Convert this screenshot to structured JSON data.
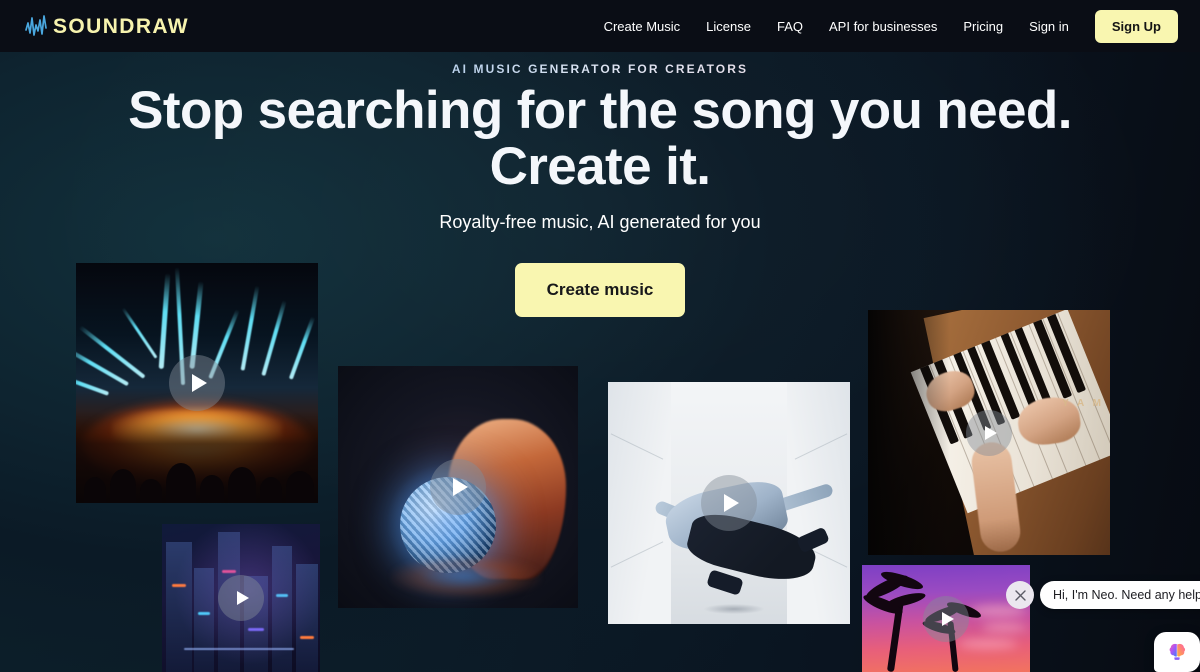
{
  "header": {
    "logo": {
      "mark_icon": "waveform-icon",
      "text": "SOUNDRAW"
    },
    "nav": [
      {
        "label": "Create Music",
        "name": "nav-create-music"
      },
      {
        "label": "License",
        "name": "nav-license"
      },
      {
        "label": "FAQ",
        "name": "nav-faq"
      },
      {
        "label": "API for businesses",
        "name": "nav-api-for-businesses"
      },
      {
        "label": "Pricing",
        "name": "nav-pricing"
      },
      {
        "label": "Sign in",
        "name": "nav-sign-in"
      }
    ],
    "signup_label": "Sign Up"
  },
  "hero": {
    "eyebrow": "AI MUSIC GENERATOR FOR CREATORS",
    "headline_line1": "Stop searching for the song you need.",
    "headline_line2": "Create it.",
    "subtitle": "Royalty-free music, AI generated for you",
    "cta_label": "Create music"
  },
  "tiles": [
    {
      "name": "tile-concert",
      "subject": "concert-laser-show",
      "play_icon": "play-icon"
    },
    {
      "name": "tile-city",
      "subject": "neon-night-cityscape",
      "play_icon": "play-icon"
    },
    {
      "name": "tile-disco",
      "subject": "woman-with-disco-ball",
      "play_icon": "play-icon"
    },
    {
      "name": "tile-dancer",
      "subject": "breakdancer-in-white-corridor",
      "play_icon": "play-icon"
    },
    {
      "name": "tile-piano",
      "subject": "hands-playing-upright-piano",
      "play_icon": "play-icon"
    },
    {
      "name": "tile-sunset",
      "subject": "palm-trees-purple-sunset",
      "play_icon": "play-icon"
    }
  ],
  "chat": {
    "message": "Hi, I'm Neo. Need any help?",
    "close_icon": "close-icon",
    "launcher_icon": "brain-icon"
  },
  "colors": {
    "brand_yellow": "#f9f6b0",
    "logo_wave": "#4aa8e0",
    "header_bg": "#0a0d15",
    "hero_bg": "#0d222c"
  },
  "piano_brand": "Y A M"
}
